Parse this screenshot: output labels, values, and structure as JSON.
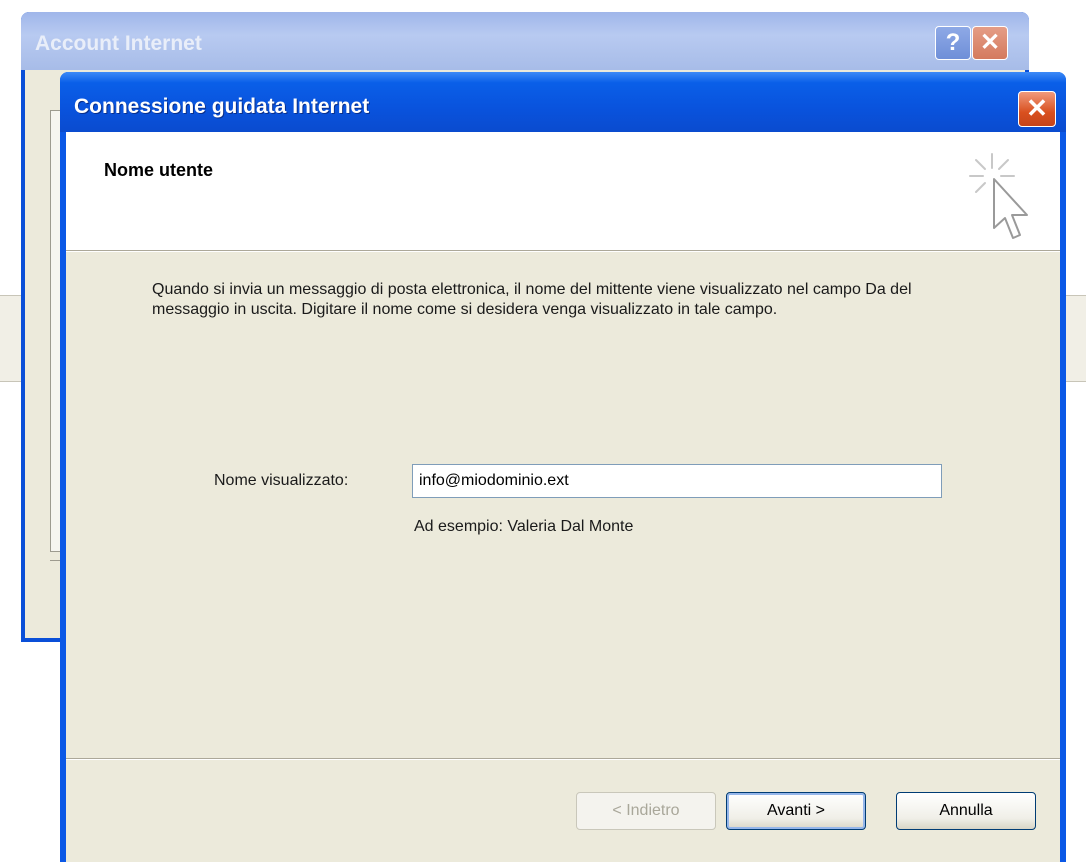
{
  "back_window": {
    "title": "Account Internet",
    "help_label": "?",
    "close_label": "✕"
  },
  "wizard": {
    "title": "Connessione guidata Internet",
    "close_label": "✕",
    "header": {
      "title": "Nome utente",
      "icon": "wizard-cursor-icon"
    },
    "description": "Quando si invia un messaggio di posta elettronica, il nome del mittente viene visualizzato nel campo Da del messaggio in uscita. Digitare il nome come si desidera venga visualizzato in tale campo.",
    "field": {
      "label": "Nome visualizzato:",
      "value": "info@miodominio.ext"
    },
    "example": "Ad esempio: Valeria Dal Monte",
    "buttons": {
      "back": "< Indietro",
      "next": "Avanti >",
      "cancel": "Annulla"
    }
  },
  "colors": {
    "titlebar_active": "#0a5fe8",
    "titlebar_inactive": "#a7bce8",
    "dialog_face": "#eceadb",
    "close_button": "#d9501f"
  }
}
